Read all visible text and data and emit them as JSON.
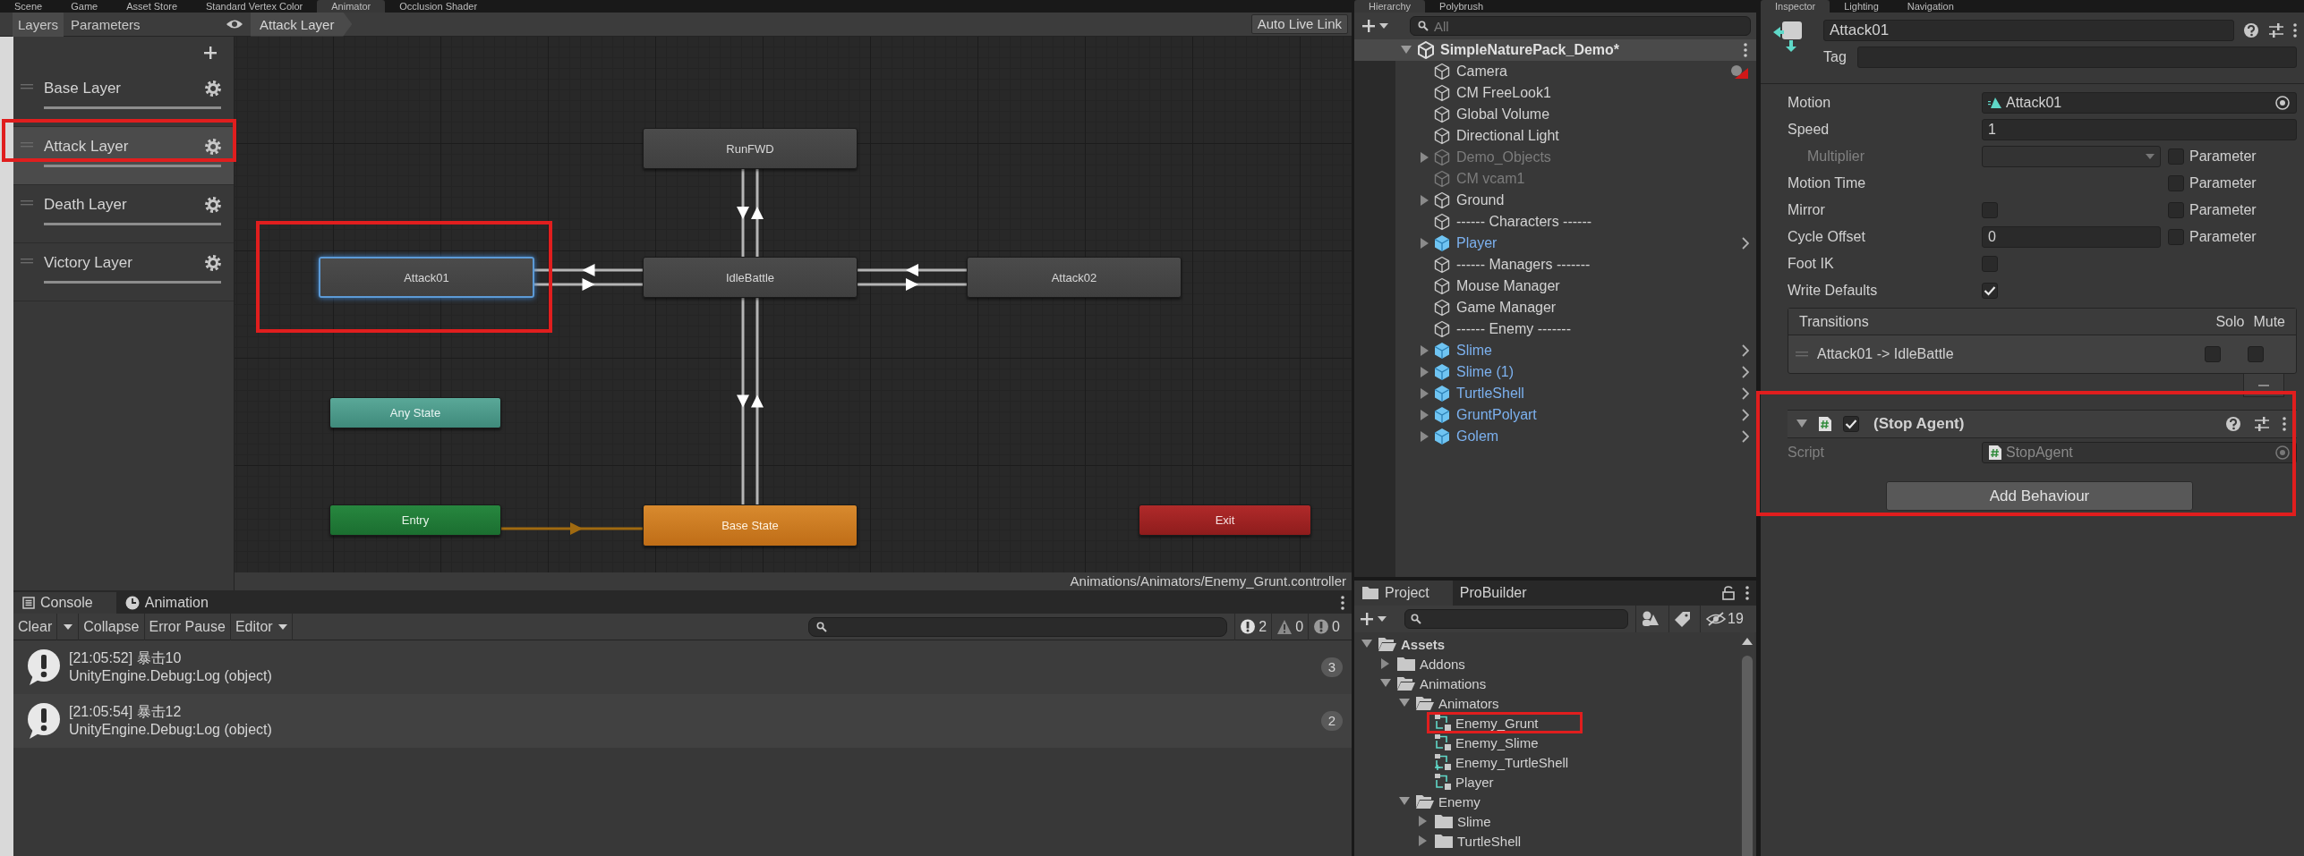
{
  "animator_window": {
    "tabs": [
      {
        "label": "Scene",
        "selected": false
      },
      {
        "label": "Game",
        "selected": false
      },
      {
        "label": "Asset Store",
        "selected": false
      },
      {
        "label": "Standard Vertex Color",
        "selected": false
      },
      {
        "label": "Animator",
        "selected": true
      },
      {
        "label": "Occlusion Shader",
        "selected": false
      }
    ],
    "view_tabs": [
      {
        "label": "Layers",
        "selected": true
      },
      {
        "label": "Parameters",
        "selected": false
      }
    ],
    "breadcrumb": "Attack Layer",
    "live_link_button": "Auto Live Link",
    "layers": [
      {
        "name": "Base Layer",
        "selected": false,
        "level": 1
      },
      {
        "name": "Attack Layer",
        "selected": true,
        "level": 1
      },
      {
        "name": "Death Layer",
        "selected": false,
        "level": 1
      },
      {
        "name": "Victory Layer",
        "selected": false,
        "level": 1
      }
    ],
    "states": [
      {
        "name": "RunFWD",
        "kind": "state",
        "selected": false
      },
      {
        "name": "Attack01",
        "kind": "state",
        "selected": true
      },
      {
        "name": "IdleBattle",
        "kind": "state",
        "selected": false
      },
      {
        "name": "Attack02",
        "kind": "state",
        "selected": false
      },
      {
        "name": "Any State",
        "kind": "any",
        "selected": false
      },
      {
        "name": "Entry",
        "kind": "entry",
        "selected": false
      },
      {
        "name": "Base State",
        "kind": "default",
        "selected": false
      },
      {
        "name": "Exit",
        "kind": "exit",
        "selected": false
      }
    ],
    "status_path": "Animations/Animators/Enemy_Grunt.controller"
  },
  "console_window": {
    "tabs": [
      {
        "label": "Console",
        "selected": true
      },
      {
        "label": "Animation",
        "selected": false
      }
    ],
    "buttons": [
      "Clear",
      "Collapse",
      "Error Pause",
      "Editor"
    ],
    "counts": [
      {
        "kind": "info",
        "count": "2"
      },
      {
        "kind": "warning",
        "count": "0"
      },
      {
        "kind": "error",
        "count": "0"
      }
    ],
    "entries": [
      {
        "message": "[21:05:52] 暴击10",
        "trace": "UnityEngine.Debug:Log (object)",
        "count": "3"
      },
      {
        "message": "[21:05:54] 暴击12",
        "trace": "UnityEngine.Debug:Log (object)",
        "count": "2"
      }
    ]
  },
  "hierarchy_window": {
    "tabs": [
      {
        "label": "Hierarchy",
        "selected": true
      },
      {
        "label": "Polybrush",
        "selected": false
      }
    ],
    "search": {
      "placeholder": "All"
    },
    "scene": "SimpleNaturePack_Demo*",
    "items": [
      {
        "name": "Camera",
        "kind": "object",
        "active": true,
        "expandable": false,
        "gizmo": true
      },
      {
        "name": "CM FreeLook1",
        "kind": "object",
        "active": true,
        "expandable": false,
        "gizmo": false
      },
      {
        "name": "Global Volume",
        "kind": "object",
        "active": true,
        "expandable": false,
        "gizmo": false
      },
      {
        "name": "Directional Light",
        "kind": "object",
        "active": true,
        "expandable": false,
        "gizmo": false
      },
      {
        "name": "Demo_Objects",
        "kind": "object",
        "active": false,
        "expandable": true,
        "gizmo": false
      },
      {
        "name": "CM vcam1",
        "kind": "object",
        "active": false,
        "expandable": false,
        "gizmo": false
      },
      {
        "name": "Ground",
        "kind": "object",
        "active": true,
        "expandable": true,
        "gizmo": false
      },
      {
        "name": "------ Characters ------",
        "kind": "object",
        "active": true,
        "expandable": false,
        "gizmo": false
      },
      {
        "name": "Player",
        "kind": "prefab",
        "active": true,
        "expandable": true,
        "gizmo": false
      },
      {
        "name": "------ Managers -------",
        "kind": "object",
        "active": true,
        "expandable": false,
        "gizmo": false
      },
      {
        "name": "Mouse Manager",
        "kind": "object",
        "active": true,
        "expandable": false,
        "gizmo": false
      },
      {
        "name": "Game Manager",
        "kind": "object",
        "active": true,
        "expandable": false,
        "gizmo": false
      },
      {
        "name": "------ Enemy -------",
        "kind": "object",
        "active": true,
        "expandable": false,
        "gizmo": false
      },
      {
        "name": "Slime",
        "kind": "prefab",
        "active": true,
        "expandable": true,
        "gizmo": false
      },
      {
        "name": "Slime (1)",
        "kind": "prefab",
        "active": true,
        "expandable": true,
        "gizmo": false
      },
      {
        "name": "TurtleShell",
        "kind": "prefab",
        "active": true,
        "expandable": true,
        "gizmo": false
      },
      {
        "name": "GruntPolyart",
        "kind": "prefab",
        "active": true,
        "expandable": true,
        "gizmo": false
      },
      {
        "name": "Golem",
        "kind": "prefab",
        "active": true,
        "expandable": true,
        "gizmo": false
      }
    ]
  },
  "project_window": {
    "tabs": [
      {
        "label": "Project",
        "selected": true
      },
      {
        "label": "ProBuilder",
        "selected": false
      }
    ],
    "hidden_count": "19",
    "tree": [
      {
        "name": "Assets",
        "kind": "folder",
        "expanded": true,
        "children": [
          {
            "name": "Addons",
            "kind": "folder",
            "expanded": false
          },
          {
            "name": "Animations",
            "kind": "folder",
            "expanded": true,
            "children": [
              {
                "name": "Animators",
                "kind": "folder",
                "expanded": true,
                "children": [
                  {
                    "name": "Enemy_Grunt",
                    "kind": "controller"
                  },
                  {
                    "name": "Enemy_Slime",
                    "kind": "controller"
                  },
                  {
                    "name": "Enemy_TurtleShell",
                    "kind": "override_controller"
                  },
                  {
                    "name": "Player",
                    "kind": "controller"
                  }
                ]
              },
              {
                "name": "Enemy",
                "kind": "folder",
                "expanded": true,
                "children": [
                  {
                    "name": "Slime",
                    "kind": "folder",
                    "expanded": false
                  },
                  {
                    "name": "TurtleShell",
                    "kind": "folder",
                    "expanded": false
                  }
                ]
              }
            ]
          }
        ]
      }
    ]
  },
  "inspector_window": {
    "tabs": [
      {
        "label": "Inspector",
        "selected": true
      },
      {
        "label": "Lighting",
        "selected": false
      },
      {
        "label": "Navigation",
        "selected": false
      }
    ],
    "name": "Attack01",
    "tag_label": "Tag",
    "properties": [
      {
        "label": "Motion",
        "kind": "object",
        "disabled": false,
        "value": "Attack01"
      },
      {
        "label": "Speed",
        "kind": "number",
        "disabled": false,
        "value": "1"
      },
      {
        "label": "Multiplier",
        "kind": "dropdown",
        "disabled": true,
        "parameter": {
          "label": "Parameter",
          "checked": false
        }
      },
      {
        "label": "Motion Time",
        "kind": "empty",
        "disabled": false,
        "parameter": {
          "label": "Parameter",
          "checked": false
        }
      },
      {
        "label": "Mirror",
        "kind": "toggle",
        "disabled": false,
        "checked": false,
        "parameter": {
          "label": "Parameter",
          "checked": false
        }
      },
      {
        "label": "Cycle Offset",
        "kind": "number",
        "disabled": false,
        "value": "0",
        "parameter": {
          "label": "Parameter",
          "checked": false
        }
      },
      {
        "label": "Foot IK",
        "kind": "toggle",
        "disabled": false,
        "checked": false
      },
      {
        "label": "Write Defaults",
        "kind": "toggle",
        "disabled": false,
        "checked": true
      }
    ],
    "transitions": {
      "title": "Transitions",
      "solo_label": "Solo",
      "mute_label": "Mute",
      "rows": [
        {
          "name": "Attack01 -> IdleBattle",
          "solo": false,
          "mute": false
        }
      ]
    },
    "behaviour": {
      "title": "(Stop Agent)",
      "expanded": true,
      "enabled": true,
      "script_label": "Script",
      "script": "StopAgent"
    },
    "add_button": "Add Behaviour"
  }
}
